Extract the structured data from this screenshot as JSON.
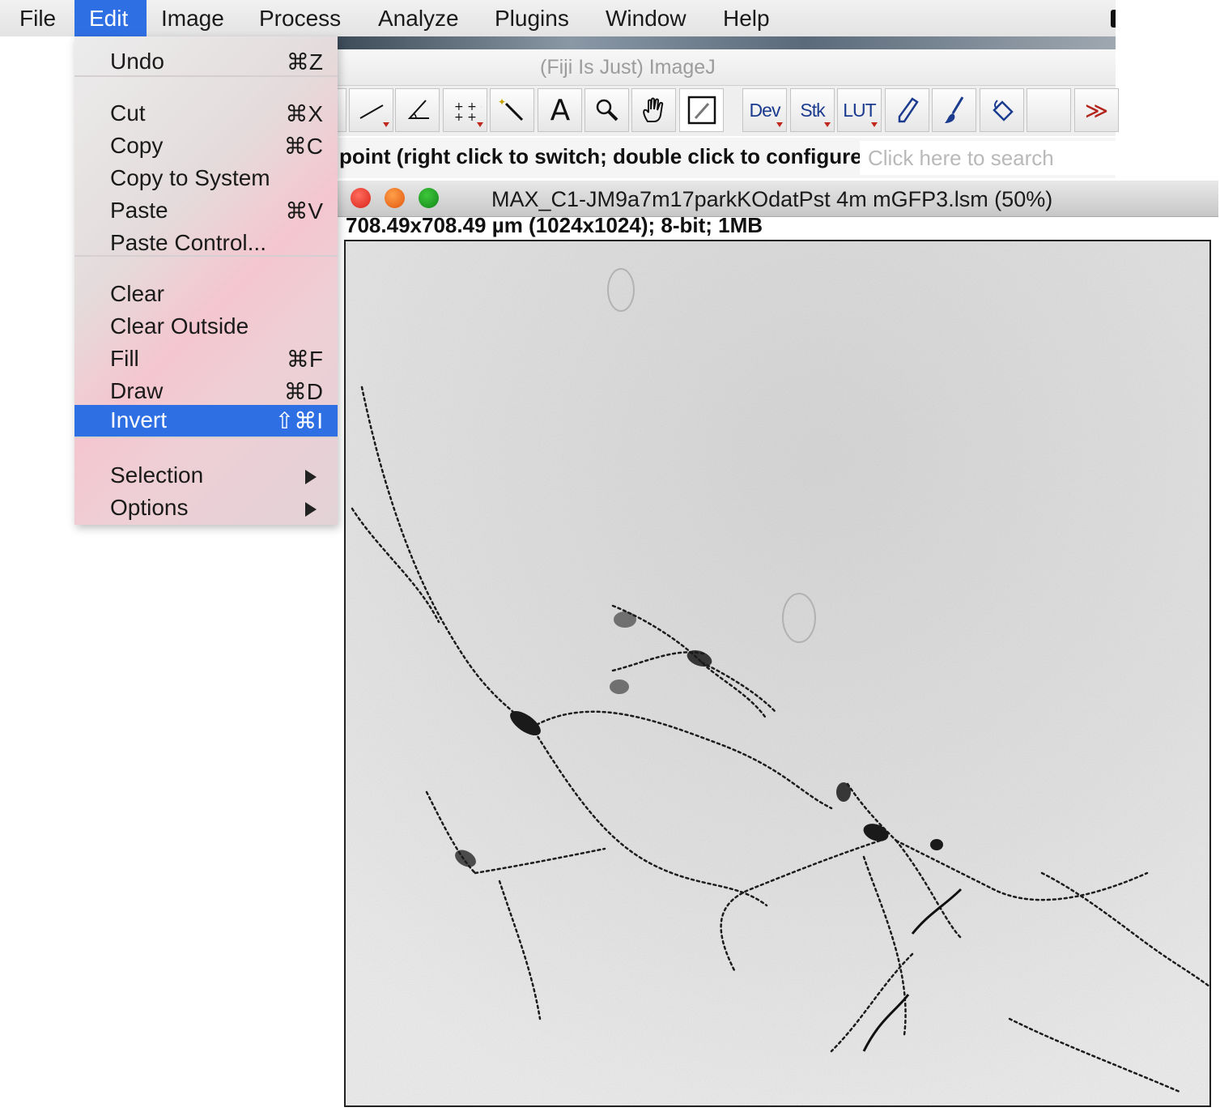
{
  "menubar": {
    "items": [
      "File",
      "Edit",
      "Image",
      "Process",
      "Analyze",
      "Plugins",
      "Window",
      "Help"
    ],
    "active": "Edit"
  },
  "edit_menu": {
    "groups": [
      [
        {
          "label": "Undo",
          "shortcut": "⌘Z"
        }
      ],
      [
        {
          "label": "Cut",
          "shortcut": "⌘X"
        },
        {
          "label": "Copy",
          "shortcut": "⌘C"
        },
        {
          "label": "Copy to System",
          "shortcut": ""
        },
        {
          "label": "Paste",
          "shortcut": "⌘V"
        },
        {
          "label": "Paste Control...",
          "shortcut": ""
        }
      ],
      [
        {
          "label": "Clear",
          "shortcut": ""
        },
        {
          "label": "Clear Outside",
          "shortcut": ""
        },
        {
          "label": "Fill",
          "shortcut": "⌘F"
        },
        {
          "label": "Draw",
          "shortcut": "⌘D"
        },
        {
          "label": "Invert",
          "shortcut": "⇧⌘I",
          "highlighted": true
        }
      ],
      [
        {
          "label": "Selection",
          "submenu": true
        },
        {
          "label": "Options",
          "submenu": true
        }
      ]
    ]
  },
  "fiji_window": {
    "title": "(Fiji Is Just) ImageJ",
    "tools": [
      {
        "name": "line-tool-icon"
      },
      {
        "name": "angle-tool-icon"
      },
      {
        "name": "multipoint-tool-icon"
      },
      {
        "name": "wand-tool-icon"
      },
      {
        "name": "text-tool-icon",
        "label": "A"
      },
      {
        "name": "zoom-tool-icon"
      },
      {
        "name": "hand-tool-icon"
      },
      {
        "name": "color-picker-tool-icon"
      },
      {
        "name": "dev-menu",
        "label": "Dev"
      },
      {
        "name": "stack-tools-menu",
        "label": "Stk"
      },
      {
        "name": "lut-menu",
        "label": "LUT"
      },
      {
        "name": "pencil-tool-icon"
      },
      {
        "name": "brush-tool-icon"
      },
      {
        "name": "flood-fill-tool-icon"
      },
      {
        "name": "empty-slot"
      },
      {
        "name": "more-tools-button",
        "label": "≫"
      }
    ],
    "status_text": "point (right click to switch; double click to configure)",
    "search_placeholder": "Click here to search"
  },
  "image_window": {
    "title": "MAX_C1-JM9a7m17parkKOdatPst 4m mGFP3.lsm (50%)",
    "info": "708.49x708.49 µm (1024x1024); 8-bit; 1MB"
  },
  "colors": {
    "menu_highlight": "#2f6fe4",
    "close": "#e0342a",
    "minimize": "#f07a1f",
    "zoom": "#1f9d22"
  }
}
